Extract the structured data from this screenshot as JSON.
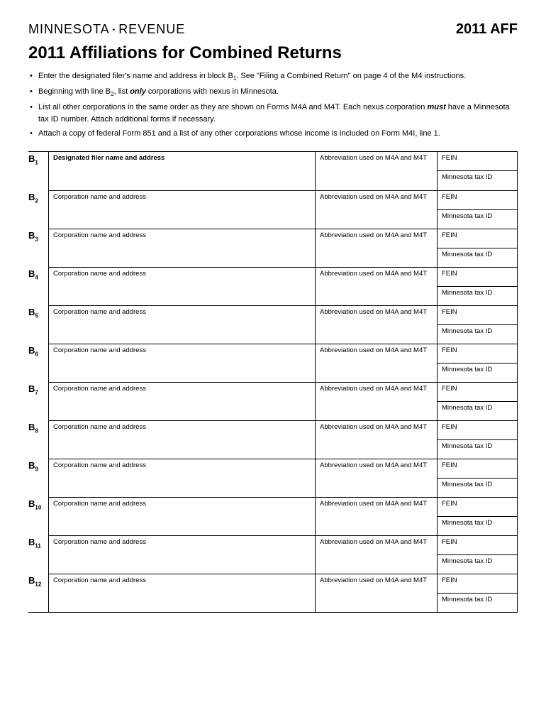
{
  "header": {
    "agency_left": "MINNESOTA",
    "agency_right": "REVENUE",
    "form_code": "2011 AFF"
  },
  "title": "2011 Affiliations for Combined Returns",
  "instructions": [
    "Enter the designated filer's name and address in block B₁. See \"Filing a Combined Return\" on page 4 of the M4 instructions.",
    "Beginning with line B₂, list only corporations with nexus in Minnesota.",
    "List all other corporations in the same order as they are shown on Forms M4A and M4T. Each nexus corporation must have a Minnesota tax ID number. Attach additional forms if necessary.",
    "Attach a copy of federal Form 851 and a list of any other corporations whose income is included on Form M4I, line 1."
  ],
  "labels": {
    "row_prefix": "B",
    "designated": "Designated filer name and address",
    "corp": "Corporation name and address",
    "abbr": "Abbreviation used on M4A and M4T",
    "fein": "FEIN",
    "mntax": "Minnesota tax ID"
  },
  "rows": [
    {
      "n": "1",
      "main_label": "Designated filer name and address"
    },
    {
      "n": "2",
      "main_label": "Corporation name and address"
    },
    {
      "n": "3",
      "main_label": "Corporation name and address"
    },
    {
      "n": "4",
      "main_label": "Corporation name and address"
    },
    {
      "n": "5",
      "main_label": "Corporation name and address"
    },
    {
      "n": "6",
      "main_label": "Corporation name and address"
    },
    {
      "n": "7",
      "main_label": "Corporation name and address"
    },
    {
      "n": "8",
      "main_label": "Corporation name and address"
    },
    {
      "n": "9",
      "main_label": "Corporation name and address"
    },
    {
      "n": "10",
      "main_label": "Corporation name and address"
    },
    {
      "n": "11",
      "main_label": "Corporation name and address"
    },
    {
      "n": "12",
      "main_label": "Corporation name and address"
    }
  ]
}
